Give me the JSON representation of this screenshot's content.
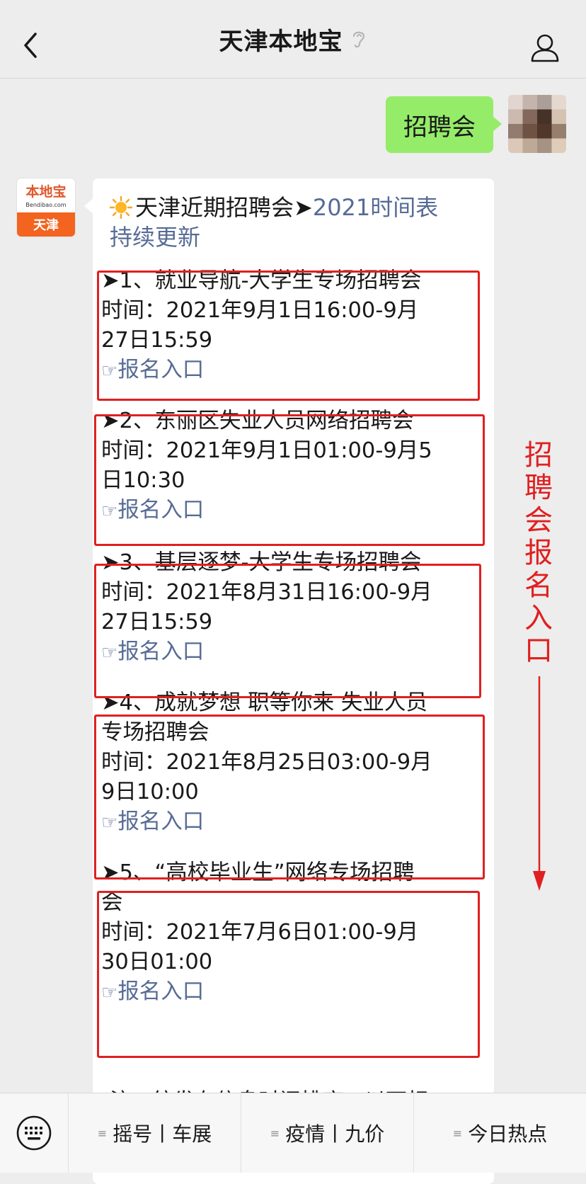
{
  "header": {
    "title": "天津本地宝"
  },
  "outgoing": {
    "text": "招聘会"
  },
  "bot": {
    "logo_top": "本地宝",
    "logo_url": "Bendibao.com",
    "logo_city": "天津"
  },
  "message": {
    "intro_plain": "天津近期招聘会➤",
    "intro_link_1": "2021时间表",
    "intro_link_2": "持续更新",
    "items": [
      {
        "title": "➤1、就业导航-大学生专场招聘会",
        "time_1": "时间：2021年9月1日16:00-9月",
        "time_2": "27日15:59",
        "hand": "☞",
        "link": "报名入口"
      },
      {
        "title": "➤2、东丽区失业人员网络招聘会",
        "time_1": "时间：2021年9月1日01:00-9月5",
        "time_2": "日10:30",
        "hand": "☞",
        "link": "报名入口"
      },
      {
        "title": "➤3、基层逐梦-大学生专场招聘会",
        "time_1": "时间：2021年8月31日16:00-9月",
        "time_2": "27日15:59",
        "hand": "☞",
        "link": "报名入口"
      },
      {
        "title": "➤4、成就梦想 职等你来 失业人员",
        "title_2": "专场招聘会",
        "time_1": "时间：2021年8月25日03:00-9月",
        "time_2": "9日10:00",
        "hand": "☞",
        "link": "报名入口"
      },
      {
        "title": "➤5、“高校毕业生”网络专场招聘",
        "title_2": "会",
        "time_1": "时间：2021年7月6日01:00-9月",
        "time_2": "30日01:00",
        "hand": "☞",
        "link": "报名入口"
      }
    ],
    "trailing_text": "注：统发布信息时间排序，以下相"
  },
  "annotation": {
    "text": "招聘会报名入口",
    "color": "#e02020"
  },
  "bottom_menu": [
    {
      "label": "摇号丨车展"
    },
    {
      "label": "疫情丨九价"
    },
    {
      "label": "今日热点"
    }
  ]
}
